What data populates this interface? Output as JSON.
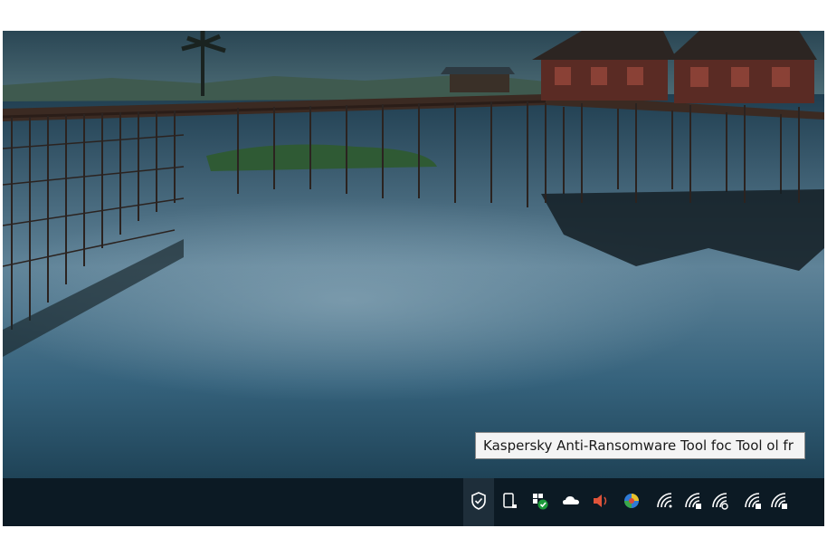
{
  "tooltip": {
    "text": "Kaspersky Anti-Ransomware Tool foc Tool ol fr"
  },
  "tray": {
    "icons": [
      {
        "name": "kaspersky-shield-icon"
      },
      {
        "name": "tablet-mode-icon"
      },
      {
        "name": "security-check-icon"
      },
      {
        "name": "onedrive-cloud-icon"
      },
      {
        "name": "volume-icon"
      },
      {
        "name": "color-app-icon"
      },
      {
        "name": "wifi-icon-1"
      },
      {
        "name": "wifi-icon-2"
      },
      {
        "name": "wifi-icon-3"
      },
      {
        "name": "wifi-icon-4"
      },
      {
        "name": "wifi-icon-5"
      }
    ]
  },
  "colors": {
    "taskbar": "#0c1a24",
    "tooltip_bg": "#f4f4f4",
    "water": "#2f5a73"
  }
}
